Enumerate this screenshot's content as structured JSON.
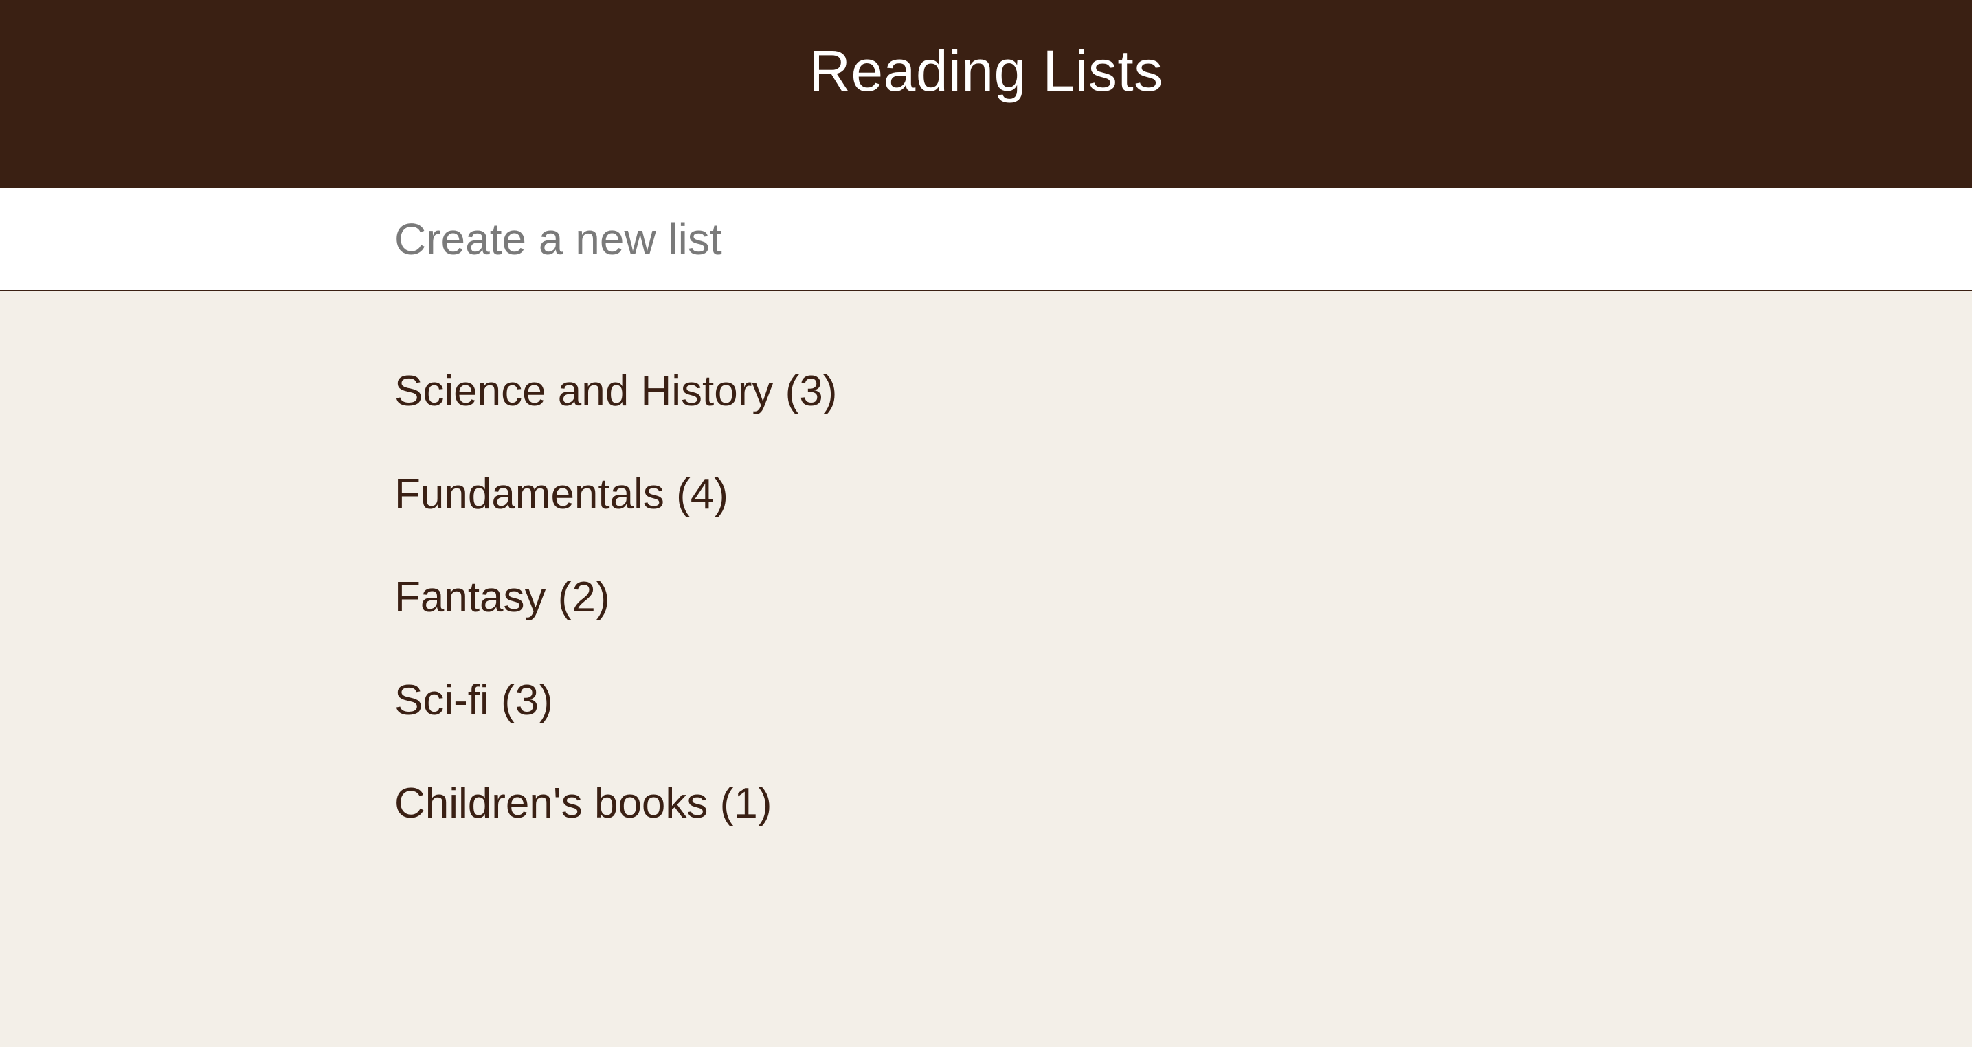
{
  "header": {
    "title": "Reading Lists"
  },
  "new_list": {
    "placeholder": "Create a new list",
    "value": ""
  },
  "lists": [
    {
      "label": "Science and History (3)"
    },
    {
      "label": "Fundamentals (4)"
    },
    {
      "label": "Fantasy (2)"
    },
    {
      "label": "Sci-fi (3)"
    },
    {
      "label": "Children's books (1)"
    }
  ],
  "colors": {
    "header_bg": "#3a2013",
    "page_bg": "#f3efe8",
    "text": "#3a2014",
    "placeholder": "#7a7a7a"
  }
}
